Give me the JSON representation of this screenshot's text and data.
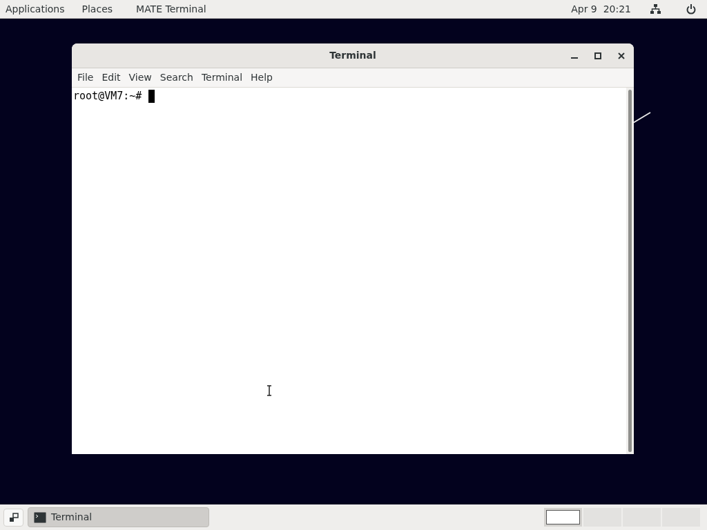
{
  "top_panel": {
    "menus": [
      "Applications",
      "Places",
      "MATE Terminal"
    ],
    "clock": "Apr 9  20:21"
  },
  "window": {
    "title": "Terminal",
    "menu": [
      "File",
      "Edit",
      "View",
      "Search",
      "Terminal",
      "Help"
    ],
    "prompt": "root@VM7:~#"
  },
  "taskbar": {
    "tasks": [
      {
        "label": "Terminal",
        "selected": true
      }
    ],
    "workspaces": [
      {
        "selected": true
      },
      {
        "selected": false
      },
      {
        "selected": false
      },
      {
        "selected": false
      }
    ]
  }
}
